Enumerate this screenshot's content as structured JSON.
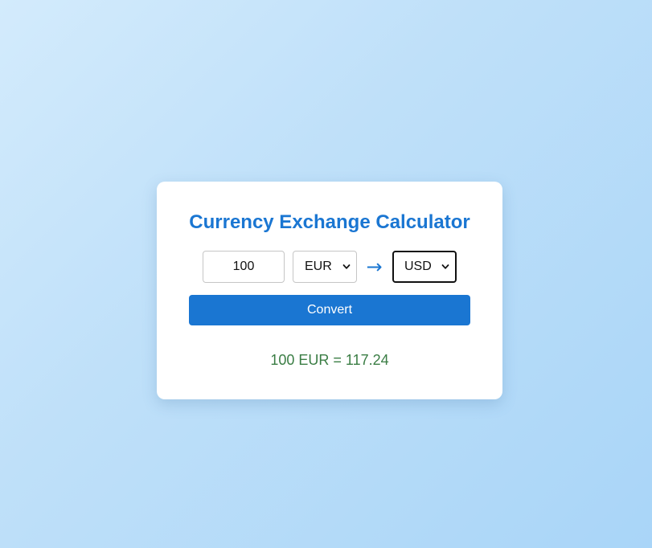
{
  "calculator": {
    "title": "Currency Exchange Calculator",
    "amount_value": "100",
    "from_currency": "EUR",
    "arrow": "→",
    "to_currency": "USD",
    "convert_label": "Convert",
    "result_text": "100 EUR = 117.24"
  },
  "colors": {
    "accent": "#1a76d2",
    "result": "#3a7d44",
    "background_start": "#d3ebfc",
    "background_end": "#a9d5f8"
  },
  "icons": {
    "arrow": "right-arrow-icon",
    "dropdown": "chevron-down-icon"
  }
}
